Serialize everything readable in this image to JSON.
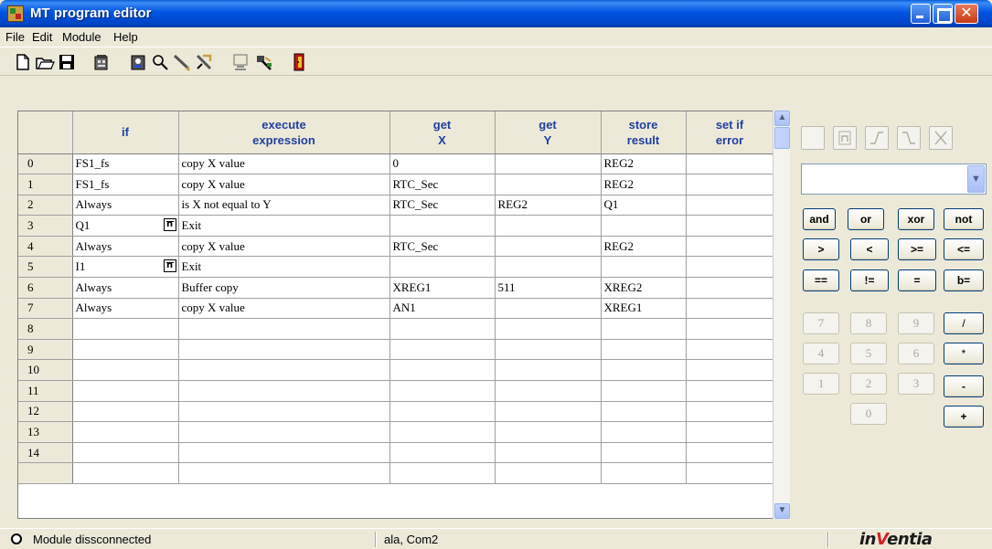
{
  "window": {
    "title": "MT program editor"
  },
  "menu": [
    "File",
    "Edit",
    "Module",
    "Help"
  ],
  "toolbar_icons": [
    "new-icon",
    "open-icon",
    "save-icon",
    "module-icon",
    "user-icon",
    "search-icon",
    "pencil-icon",
    "tools-icon",
    "monitor-icon",
    "network-icon",
    "exit-door-icon"
  ],
  "grid": {
    "columns": [
      {
        "line1": "if",
        "line2": ""
      },
      {
        "line1": "execute",
        "line2": "expression"
      },
      {
        "line1": "get",
        "line2": "X"
      },
      {
        "line1": "get",
        "line2": "Y"
      },
      {
        "line1": "store",
        "line2": "result"
      },
      {
        "line1": "set if",
        "line2": "error"
      }
    ],
    "rows": [
      {
        "num": "0",
        "if": "FS1_fs",
        "icon": false,
        "expr": "copy X value",
        "x": "0",
        "y": "",
        "result": "REG2",
        "err": ""
      },
      {
        "num": "1",
        "if": "FS1_fs",
        "icon": false,
        "expr": "copy X value",
        "x": "RTC_Sec",
        "y": "",
        "result": "REG2",
        "err": ""
      },
      {
        "num": "2",
        "if": "Always",
        "icon": false,
        "expr": "is X not equal to Y",
        "x": "RTC_Sec",
        "y": "REG2",
        "result": "Q1",
        "err": ""
      },
      {
        "num": "3",
        "if": "Q1",
        "icon": true,
        "expr": "Exit",
        "x": "",
        "y": "",
        "result": "",
        "err": ""
      },
      {
        "num": "4",
        "if": "Always",
        "icon": false,
        "expr": "copy X value",
        "x": "RTC_Sec",
        "y": "",
        "result": "REG2",
        "err": ""
      },
      {
        "num": "5",
        "if": "I1",
        "icon": true,
        "expr": "Exit",
        "x": "",
        "y": "",
        "result": "",
        "err": ""
      },
      {
        "num": "6",
        "if": "Always",
        "icon": false,
        "expr": "Buffer copy",
        "x": "XREG1",
        "y": "511",
        "result": "XREG2",
        "err": ""
      },
      {
        "num": "7",
        "if": "Always",
        "icon": false,
        "expr": "copy X value",
        "x": "AN1",
        "y": "",
        "result": "XREG1",
        "err": ""
      },
      {
        "num": "8",
        "if": "",
        "icon": false,
        "expr": "",
        "x": "",
        "y": "",
        "result": "",
        "err": ""
      },
      {
        "num": "9",
        "if": "",
        "icon": false,
        "expr": "",
        "x": "",
        "y": "",
        "result": "",
        "err": ""
      },
      {
        "num": "10",
        "if": "",
        "icon": false,
        "expr": "",
        "x": "",
        "y": "",
        "result": "",
        "err": ""
      },
      {
        "num": "11",
        "if": "",
        "icon": false,
        "expr": "",
        "x": "",
        "y": "",
        "result": "",
        "err": ""
      },
      {
        "num": "12",
        "if": "",
        "icon": false,
        "expr": "",
        "x": "",
        "y": "",
        "result": "",
        "err": ""
      },
      {
        "num": "13",
        "if": "",
        "icon": false,
        "expr": "",
        "x": "",
        "y": "",
        "result": "",
        "err": ""
      },
      {
        "num": "14",
        "if": "",
        "icon": false,
        "expr": "",
        "x": "",
        "y": "",
        "result": "",
        "err": ""
      }
    ]
  },
  "panel": {
    "symbols": [
      "box-icon",
      "n-bar-icon",
      "rising-edge-icon",
      "falling-edge-icon",
      "x-box-icon"
    ],
    "combo_value": "",
    "operators": [
      [
        "and",
        "or",
        "xor",
        "not"
      ],
      [
        ">",
        "<",
        ">=",
        "<="
      ],
      [
        "==",
        "!=",
        "=",
        "b="
      ]
    ],
    "numpad": [
      [
        "7",
        "8",
        "9"
      ],
      [
        "4",
        "5",
        "6"
      ],
      [
        "1",
        "2",
        "3"
      ],
      [
        "0"
      ]
    ],
    "arith": [
      "/",
      "*",
      "-",
      "+"
    ]
  },
  "status": {
    "connection": "Module dissconnected",
    "port": "ala, Com2",
    "logo_pre": "in",
    "logo_accent": "V",
    "logo_post": "entia"
  }
}
